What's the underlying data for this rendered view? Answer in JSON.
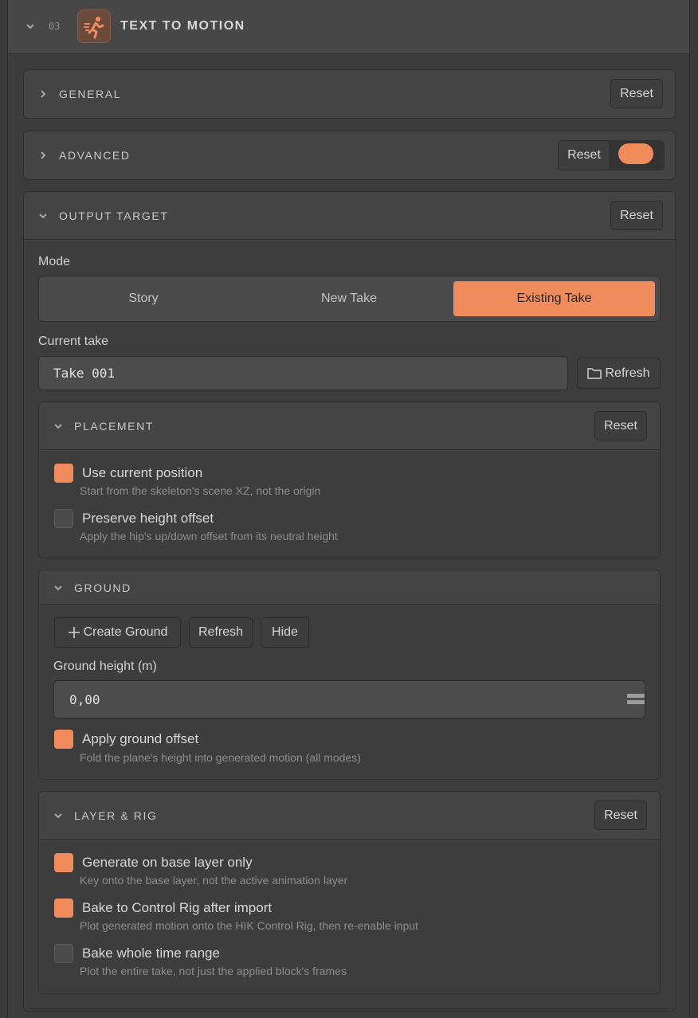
{
  "root": {
    "step_number": "03",
    "title": "TEXT TO MOTION"
  },
  "general": {
    "title": "GENERAL",
    "reset_label": "Reset"
  },
  "advanced": {
    "title": "ADVANCED",
    "reset_label": "Reset",
    "enabled": true
  },
  "output_target": {
    "title": "OUTPUT TARGET",
    "reset_label": "Reset",
    "mode_label": "Mode",
    "modes": [
      "Story",
      "New Take",
      "Existing Take"
    ],
    "selected_mode": "Existing Take",
    "current_take_label": "Current take",
    "current_take_value": "Take 001",
    "refresh_label": "Refresh"
  },
  "placement": {
    "title": "PLACEMENT",
    "reset_label": "Reset",
    "options": [
      {
        "label": "Use current position",
        "desc": "Start from the skeleton's scene XZ, not the origin",
        "checked": true
      },
      {
        "label": "Preserve height offset",
        "desc": "Apply the hip's up/down offset from its neutral height",
        "checked": false
      }
    ]
  },
  "ground": {
    "title": "GROUND",
    "create_label": "Create Ground",
    "refresh_label": "Refresh",
    "hide_label": "Hide",
    "height_label": "Ground height (m)",
    "height_value": "0,00",
    "options": [
      {
        "label": "Apply ground offset",
        "desc": "Fold the plane's height into generated motion (all modes)",
        "checked": true
      }
    ]
  },
  "layer_rig": {
    "title": "LAYER & RIG",
    "reset_label": "Reset",
    "options": [
      {
        "label": "Generate on base layer only",
        "desc": "Key onto the base layer, not the active animation layer",
        "checked": true
      },
      {
        "label": "Bake to Control Rig after import",
        "desc": "Plot generated motion onto the HIK Control Rig, then re-enable input",
        "checked": true
      },
      {
        "label": "Bake whole time range",
        "desc": "Plot the entire take, not just the applied block's frames",
        "checked": false
      }
    ]
  },
  "colors": {
    "accent": "#f08c5c",
    "panel": "#444444",
    "background": "#3c3c3c"
  },
  "icons": [
    "chevron-down-icon",
    "chevron-right-icon",
    "running-figure-icon",
    "folder-icon",
    "plus-icon",
    "drag-handle-icon"
  ]
}
